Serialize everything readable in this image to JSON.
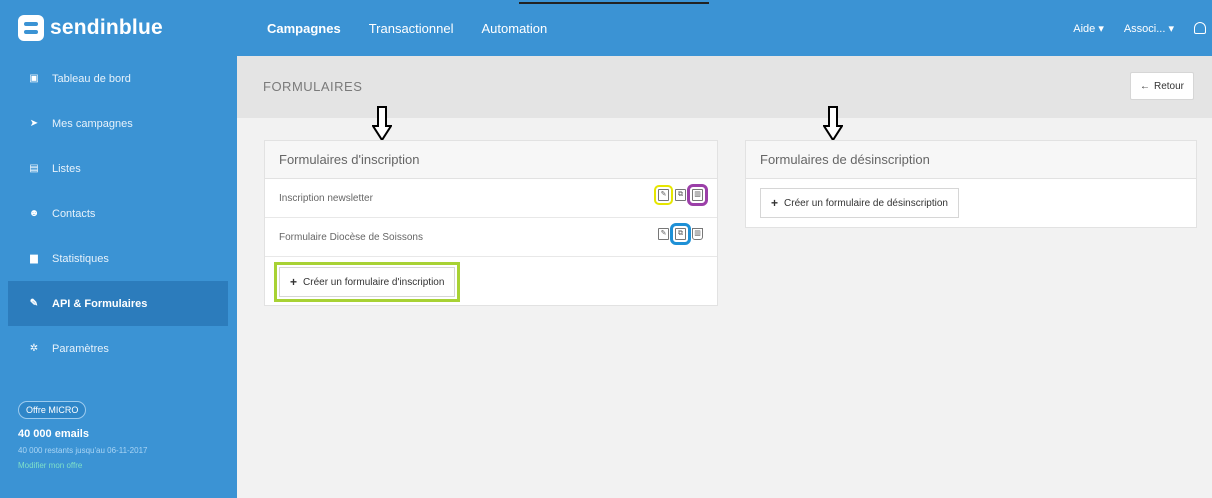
{
  "brand": {
    "name": "sendinblue"
  },
  "sidebar": {
    "items": [
      {
        "label": "Tableau de bord",
        "icon": "dashboard-icon",
        "glyph": "▣"
      },
      {
        "label": "Mes campagnes",
        "icon": "send-icon",
        "glyph": "➤"
      },
      {
        "label": "Listes",
        "icon": "list-icon",
        "glyph": "▤"
      },
      {
        "label": "Contacts",
        "icon": "users-icon",
        "glyph": "☻"
      },
      {
        "label": "Statistiques",
        "icon": "chart-icon",
        "glyph": "▆"
      },
      {
        "label": "API & Formulaires",
        "icon": "wrench-icon",
        "glyph": "✎"
      },
      {
        "label": "Paramètres",
        "icon": "gear-icon",
        "glyph": "✲"
      }
    ],
    "active_index": 5,
    "offer": {
      "badge": "Offre MICRO",
      "emails": "40 000 emails",
      "note": "40 000 restants jusqu'au 06-11-2017",
      "link": "Modifier mon offre"
    }
  },
  "topbar": {
    "tabs": [
      "Campagnes",
      "Transactionnel",
      "Automation"
    ],
    "active_tab": 0,
    "help": "Aide",
    "account": "Associ..."
  },
  "page": {
    "title": "FORMULAIRES",
    "back_label": "Retour"
  },
  "inscription": {
    "title": "Formulaires d'inscription",
    "rows": [
      {
        "name": "Inscription newsletter"
      },
      {
        "name": "Formulaire Diocèse de Soissons"
      }
    ],
    "create_label": "Créer un formulaire d'inscription"
  },
  "desinscription": {
    "title": "Formulaires de désinscription",
    "create_label": "Créer un formulaire de désinscription"
  },
  "colors": {
    "brand_blue": "#3b93d4",
    "highlight_yellow": "#e6e600",
    "highlight_purple": "#9b3fa8",
    "highlight_blue": "#1e90d6",
    "highlight_green": "#a8d234"
  }
}
